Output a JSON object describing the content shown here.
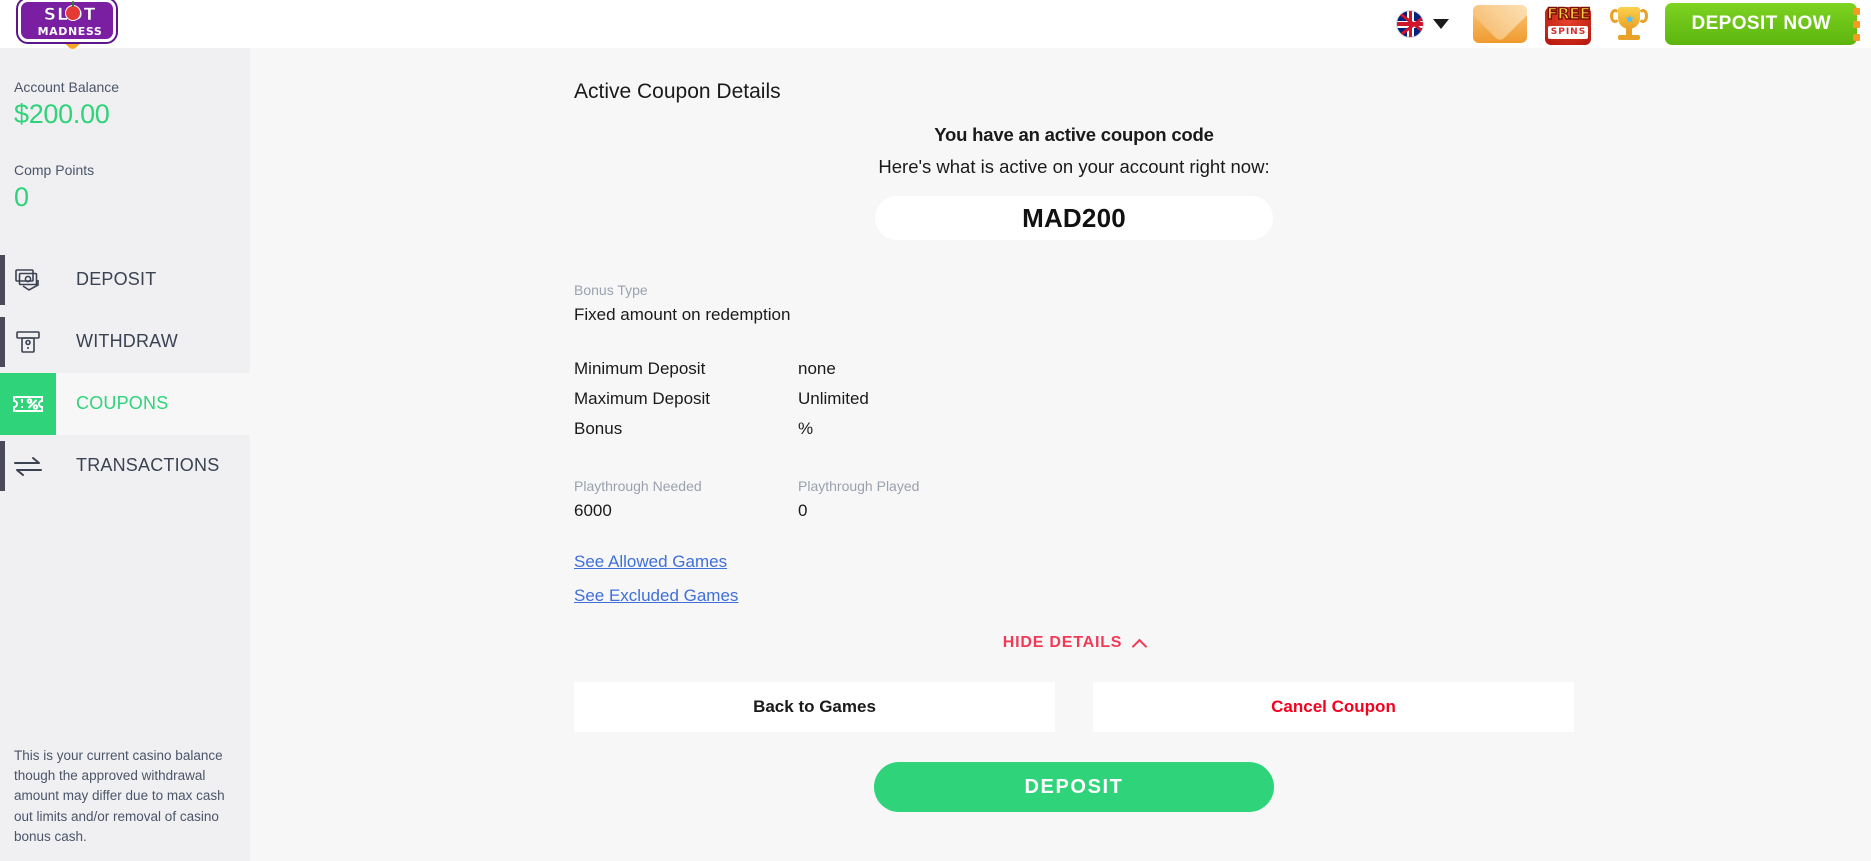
{
  "brand": {
    "logo_top": "SLOT",
    "logo_bottom": "MADNESS",
    "accent_green": "#2fd37a",
    "accent_red": "#f23a57",
    "accent_link": "#3f6fd8",
    "header_button_green": "#5cb50f",
    "dots_orange": "#f79a21"
  },
  "header": {
    "language": "English",
    "language_icon": "uk-flag-icon",
    "dropdown_icon": "chevron-down-icon",
    "mail_icon": "envelope-icon",
    "free_spins_line1": "FREE",
    "free_spins_line2": "SPINS",
    "trophy_icon": "trophy-icon",
    "deposit_now_label": "DEPOSIT NOW",
    "menu_icon": "vertical-dots-menu-icon"
  },
  "sidebar": {
    "balance_label": "Account Balance",
    "balance_value": "$200.00",
    "comp_points_label": "Comp Points",
    "comp_points_value": "0",
    "items": [
      {
        "label": "DEPOSIT",
        "icon": "banknote-hand-icon",
        "active": false
      },
      {
        "label": "WITHDRAW",
        "icon": "atm-machine-icon",
        "active": false
      },
      {
        "label": "COUPONS",
        "icon": "coupon-percent-icon",
        "active": true
      },
      {
        "label": "TRANSACTIONS",
        "icon": "transfer-arrows-icon",
        "active": false
      }
    ],
    "disclaimer": "This is your current casino balance though the approved withdrawal amount may differ due to max cash out limits and/or removal of casino bonus cash."
  },
  "main": {
    "page_title": "Active Coupon Details",
    "lead": "You have an active coupon code",
    "sub": "Here's what is active on your account right now:",
    "coupon_code": "MAD200",
    "bonus_type_label": "Bonus Type",
    "bonus_type_value": "Fixed amount on redemption",
    "rows": [
      {
        "key": "Minimum Deposit",
        "value": "none"
      },
      {
        "key": "Maximum Deposit",
        "value": "Unlimited"
      },
      {
        "key": "Bonus",
        "value": "%"
      }
    ],
    "playthrough_needed_label": "Playthrough Needed",
    "playthrough_needed_value": "6000",
    "playthrough_played_label": "Playthrough Played",
    "playthrough_played_value": "0",
    "link_allowed": "See Allowed Games",
    "link_excluded": "See Excluded Games",
    "hide_details_label": "HIDE DETAILS",
    "hide_details_icon": "chevron-up-icon",
    "back_to_games_label": "Back to Games",
    "cancel_coupon_label": "Cancel Coupon",
    "deposit_label": "DEPOSIT"
  }
}
